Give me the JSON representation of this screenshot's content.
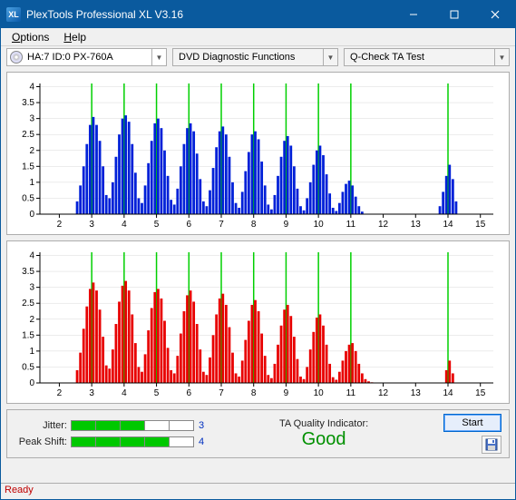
{
  "window": {
    "title": "PlexTools Professional XL V3.16",
    "icon_text": "XL"
  },
  "menu": {
    "options": {
      "u": "O",
      "rest": "ptions"
    },
    "help": {
      "u": "H",
      "rest": "elp"
    }
  },
  "toolbar": {
    "device": "HA:7 ID:0   PX-760A",
    "dd1": "DVD Diagnostic Functions",
    "dd2": "Q-Check TA Test"
  },
  "chart_axes": {
    "y_ticks": [
      0,
      0.5,
      1,
      1.5,
      2,
      2.5,
      3,
      3.5,
      4
    ],
    "x_ticks": [
      2,
      3,
      4,
      5,
      6,
      7,
      8,
      9,
      10,
      11,
      12,
      13,
      14,
      15
    ],
    "x_min": 1.4,
    "x_max": 15.4,
    "y_min": 0,
    "y_max": 4.1,
    "green_lines": [
      3,
      4,
      5,
      6,
      7,
      8,
      9,
      10,
      11,
      14
    ]
  },
  "chart_data": [
    {
      "type": "bar",
      "color": "#0020d8",
      "title": "",
      "xlabel": "",
      "ylabel": "",
      "ylim": [
        0,
        4.1
      ],
      "x": [
        2.55,
        2.65,
        2.75,
        2.85,
        2.95,
        3.05,
        3.15,
        3.25,
        3.35,
        3.45,
        3.55,
        3.65,
        3.75,
        3.85,
        3.95,
        4.05,
        4.15,
        4.25,
        4.35,
        4.45,
        4.55,
        4.65,
        4.75,
        4.85,
        4.95,
        5.05,
        5.15,
        5.25,
        5.35,
        5.45,
        5.55,
        5.65,
        5.75,
        5.85,
        5.95,
        6.05,
        6.15,
        6.25,
        6.35,
        6.45,
        6.55,
        6.65,
        6.75,
        6.85,
        6.95,
        7.05,
        7.15,
        7.25,
        7.35,
        7.45,
        7.55,
        7.65,
        7.75,
        7.85,
        7.95,
        8.05,
        8.15,
        8.25,
        8.35,
        8.45,
        8.55,
        8.65,
        8.75,
        8.85,
        8.95,
        9.05,
        9.15,
        9.25,
        9.35,
        9.45,
        9.55,
        9.65,
        9.75,
        9.85,
        9.95,
        10.05,
        10.15,
        10.25,
        10.35,
        10.45,
        10.55,
        10.65,
        10.75,
        10.85,
        10.95,
        11.05,
        11.15,
        11.25,
        11.35,
        13.75,
        13.85,
        13.95,
        14.05,
        14.15,
        14.25
      ],
      "values": [
        0.4,
        0.9,
        1.5,
        2.2,
        2.8,
        3.05,
        2.8,
        2.3,
        1.5,
        0.6,
        0.5,
        1.0,
        1.8,
        2.5,
        3.0,
        3.1,
        2.9,
        2.2,
        1.3,
        0.5,
        0.35,
        0.9,
        1.6,
        2.3,
        2.85,
        3.0,
        2.7,
        2.0,
        1.2,
        0.45,
        0.3,
        0.8,
        1.5,
        2.2,
        2.7,
        2.85,
        2.6,
        1.9,
        1.1,
        0.4,
        0.25,
        0.75,
        1.45,
        2.1,
        2.6,
        2.75,
        2.5,
        1.8,
        1.0,
        0.35,
        0.2,
        0.7,
        1.35,
        1.95,
        2.5,
        2.6,
        2.35,
        1.65,
        0.9,
        0.3,
        0.15,
        0.6,
        1.2,
        1.8,
        2.3,
        2.45,
        2.15,
        1.5,
        0.8,
        0.25,
        0.12,
        0.5,
        1.0,
        1.55,
        2.0,
        2.15,
        1.85,
        1.25,
        0.65,
        0.2,
        0.1,
        0.35,
        0.7,
        0.95,
        1.05,
        0.9,
        0.55,
        0.25,
        0.08,
        0.25,
        0.7,
        1.2,
        1.55,
        1.1,
        0.4
      ]
    },
    {
      "type": "bar",
      "color": "#e80000",
      "title": "",
      "xlabel": "",
      "ylabel": "",
      "ylim": [
        0,
        4.1
      ],
      "x": [
        2.55,
        2.65,
        2.75,
        2.85,
        2.95,
        3.05,
        3.15,
        3.25,
        3.35,
        3.45,
        3.55,
        3.65,
        3.75,
        3.85,
        3.95,
        4.05,
        4.15,
        4.25,
        4.35,
        4.45,
        4.55,
        4.65,
        4.75,
        4.85,
        4.95,
        5.05,
        5.15,
        5.25,
        5.35,
        5.45,
        5.55,
        5.65,
        5.75,
        5.85,
        5.95,
        6.05,
        6.15,
        6.25,
        6.35,
        6.45,
        6.55,
        6.65,
        6.75,
        6.85,
        6.95,
        7.05,
        7.15,
        7.25,
        7.35,
        7.45,
        7.55,
        7.65,
        7.75,
        7.85,
        7.95,
        8.05,
        8.15,
        8.25,
        8.35,
        8.45,
        8.55,
        8.65,
        8.75,
        8.85,
        8.95,
        9.05,
        9.15,
        9.25,
        9.35,
        9.45,
        9.55,
        9.65,
        9.75,
        9.85,
        9.95,
        10.05,
        10.15,
        10.25,
        10.35,
        10.45,
        10.55,
        10.65,
        10.75,
        10.85,
        10.95,
        11.05,
        11.15,
        11.25,
        11.35,
        11.45,
        11.55,
        11.65,
        13.95,
        14.05,
        14.15
      ],
      "values": [
        0.4,
        0.95,
        1.7,
        2.4,
        2.95,
        3.15,
        2.9,
        2.3,
        1.45,
        0.55,
        0.45,
        1.05,
        1.85,
        2.55,
        3.05,
        3.2,
        2.9,
        2.15,
        1.25,
        0.5,
        0.35,
        0.9,
        1.65,
        2.35,
        2.85,
        2.95,
        2.65,
        1.95,
        1.1,
        0.4,
        0.3,
        0.85,
        1.55,
        2.25,
        2.75,
        2.9,
        2.55,
        1.85,
        1.05,
        0.35,
        0.25,
        0.8,
        1.5,
        2.15,
        2.65,
        2.8,
        2.45,
        1.75,
        0.95,
        0.3,
        0.2,
        0.7,
        1.35,
        1.95,
        2.45,
        2.6,
        2.25,
        1.55,
        0.85,
        0.25,
        0.15,
        0.6,
        1.2,
        1.8,
        2.3,
        2.45,
        2.1,
        1.45,
        0.75,
        0.2,
        0.12,
        0.5,
        1.05,
        1.6,
        2.05,
        2.15,
        1.8,
        1.2,
        0.6,
        0.18,
        0.1,
        0.35,
        0.7,
        1.0,
        1.2,
        1.25,
        1.0,
        0.6,
        0.3,
        0.12,
        0.05,
        0.02,
        0.4,
        0.7,
        0.3
      ]
    }
  ],
  "metrics": {
    "jitter": {
      "label": "Jitter:",
      "value": "3",
      "filled": 3,
      "total": 5
    },
    "peakshift": {
      "label": "Peak Shift:",
      "value": "4",
      "filled": 4,
      "total": 5
    }
  },
  "quality": {
    "label": "TA Quality Indicator:",
    "value": "Good"
  },
  "buttons": {
    "start": "Start"
  },
  "status": {
    "text": "Ready"
  }
}
